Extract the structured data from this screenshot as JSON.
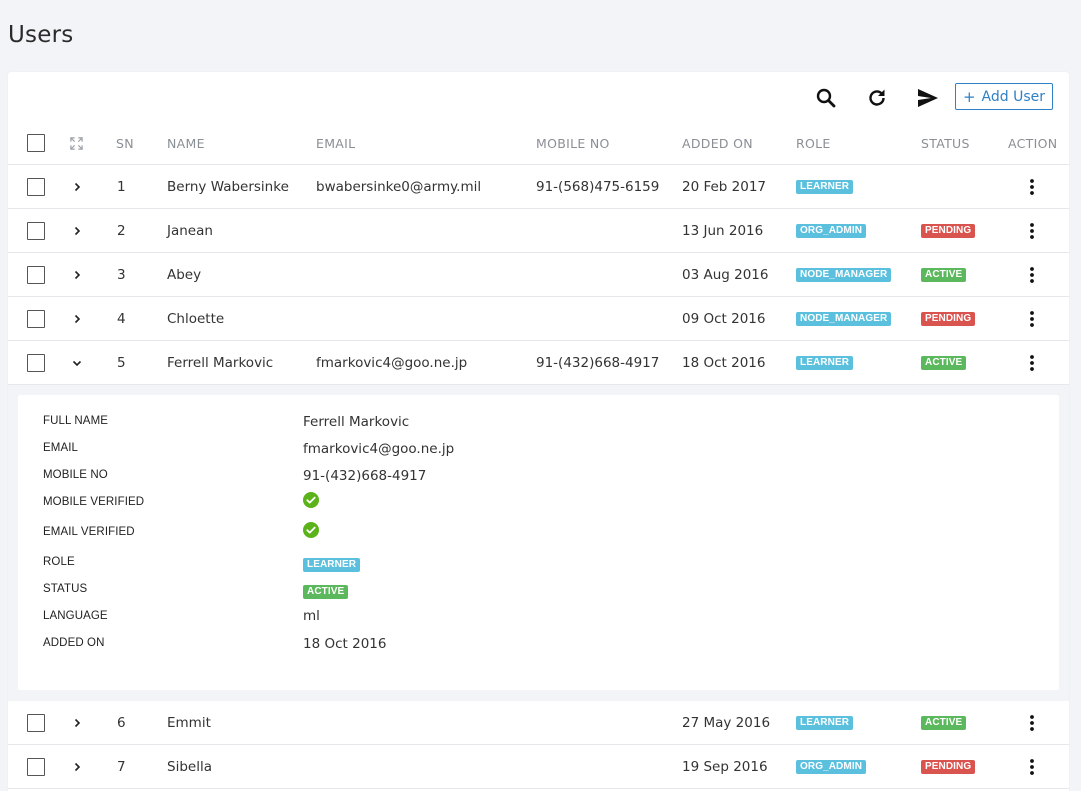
{
  "page": {
    "title": "Users"
  },
  "toolbar": {
    "search_icon": "search-icon",
    "refresh_icon": "refresh-icon",
    "send_icon": "send-icon",
    "add_user_plus": "+",
    "add_user_label": "Add User"
  },
  "table": {
    "columns": {
      "sn": "SN",
      "name": "NAME",
      "email": "EMAIL",
      "mobile": "MOBILE NO",
      "added_on": "ADDED ON",
      "role": "ROLE",
      "status": "STATUS",
      "action": "ACTION"
    },
    "rows": [
      {
        "sn": "1",
        "name": "Berny Wabersinke",
        "email": "bwabersinke0@army.mil",
        "mobile": "91-(568)475-6159",
        "added_on": "20 Feb 2017",
        "role": "LEARNER",
        "status": ""
      },
      {
        "sn": "2",
        "name": "Janean",
        "email": "",
        "mobile": "",
        "added_on": "13 Jun 2016",
        "role": "ORG_ADMIN",
        "status": "PENDING"
      },
      {
        "sn": "3",
        "name": "Abey",
        "email": "",
        "mobile": "",
        "added_on": "03 Aug 2016",
        "role": "NODE_MANAGER",
        "status": "ACTIVE"
      },
      {
        "sn": "4",
        "name": "Chloette",
        "email": "",
        "mobile": "",
        "added_on": "09 Oct 2016",
        "role": "NODE_MANAGER",
        "status": "PENDING"
      },
      {
        "sn": "5",
        "name": "Ferrell Markovic",
        "email": "fmarkovic4@goo.ne.jp",
        "mobile": "91-(432)668-4917",
        "added_on": "18 Oct 2016",
        "role": "LEARNER",
        "status": "ACTIVE"
      },
      {
        "sn": "6",
        "name": "Emmit",
        "email": "",
        "mobile": "",
        "added_on": "27 May 2016",
        "role": "LEARNER",
        "status": "ACTIVE"
      },
      {
        "sn": "7",
        "name": "Sibella",
        "email": "",
        "mobile": "",
        "added_on": "19 Sep 2016",
        "role": "ORG_ADMIN",
        "status": "PENDING"
      }
    ]
  },
  "detail": {
    "labels": {
      "full_name": "FULL NAME",
      "email": "EMAIL",
      "mobile": "MOBILE NO",
      "mobile_verified": "MOBILE VERIFIED",
      "email_verified": "EMAIL VERIFIED",
      "role": "ROLE",
      "status": "STATUS",
      "language": "LANGUAGE",
      "added_on": "ADDED ON"
    },
    "values": {
      "full_name": "Ferrell Markovic",
      "email": "fmarkovic4@goo.ne.jp",
      "mobile": "91-(432)668-4917",
      "role": "LEARNER",
      "status": "ACTIVE",
      "language": "ml",
      "added_on": "18 Oct 2016"
    }
  },
  "colors": {
    "learner": "#5bc0de",
    "org_admin": "#5bc0de",
    "node_manager": "#5bc0de",
    "active": "#5cb85c",
    "pending": "#d9534f",
    "verified": "#5cb21a",
    "accent": "#2f80c4"
  }
}
